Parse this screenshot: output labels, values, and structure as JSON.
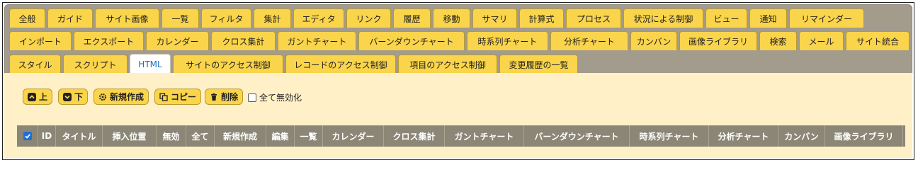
{
  "tabs": [
    "全般",
    "ガイド",
    "サイト画像",
    "一覧",
    "フィルタ",
    "集計",
    "エディタ",
    "リンク",
    "履歴",
    "移動",
    "サマリ",
    "計算式",
    "プロセス",
    "状況による制御",
    "ビュー",
    "通知",
    "リマインダー",
    "インポート",
    "エクスポート",
    "カレンダー",
    "クロス集計",
    "ガントチャート",
    "バーンダウンチャート",
    "時系列チャート",
    "分析チャート",
    "カンバン",
    "画像ライブラリ",
    "検索",
    "メール",
    "サイト統合",
    "スタイル",
    "スクリプト",
    "HTML",
    "サイトのアクセス制御",
    "レコードのアクセス制御",
    "項目のアクセス制御",
    "変更履歴の一覧"
  ],
  "active_tab": "HTML",
  "toolbar": {
    "up": "上",
    "down": "下",
    "new": "新規作成",
    "copy": "コピー",
    "delete": "削除",
    "disable_all": "全て無効化"
  },
  "grid": {
    "columns": [
      "ID",
      "タイトル",
      "挿入位置",
      "無効",
      "全て",
      "新規作成",
      "編集",
      "一覧",
      "カレンダー",
      "クロス集計",
      "ガントチャート",
      "バーンダウンチャート",
      "時系列チャート",
      "分析チャート",
      "カンバン",
      "画像ライブラリ"
    ]
  },
  "colors": {
    "tab": "#fad44a",
    "active_tab_text": "#1a6fbf",
    "tab_strip": "#a39b8c",
    "content_bg": "#fff0c8",
    "header_bg": "#8b8676",
    "header_check": "#1e6fd9"
  }
}
